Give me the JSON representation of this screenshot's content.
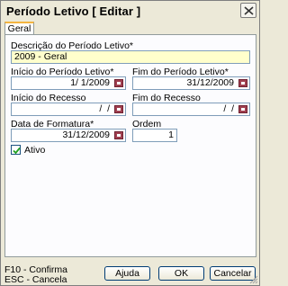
{
  "window": {
    "title": "Período Letivo [ Editar ]"
  },
  "tabs": [
    {
      "label": "Geral"
    }
  ],
  "form": {
    "descricao": {
      "label": "Descrição do Período Letivo*",
      "value": "2009 - Geral"
    },
    "inicio_periodo": {
      "label": "Início do Período Letivo*",
      "value": "1/ 1/2009"
    },
    "fim_periodo": {
      "label": "Fim do Período Letivo*",
      "value": "31/12/2009"
    },
    "inicio_recesso": {
      "label": "Início do Recesso",
      "value": " /  /"
    },
    "fim_recesso": {
      "label": "Fim do Recesso",
      "value": " /  /"
    },
    "data_formatura": {
      "label": "Data de Formatura*",
      "value": "31/12/2009"
    },
    "ordem": {
      "label": "Ordem",
      "value": "1"
    },
    "ativo": {
      "label": "Ativo",
      "checked": true
    }
  },
  "footer": {
    "shortcut_confirm": "F10 - Confirma",
    "shortcut_cancel": "ESC - Cancela",
    "help_label": "Ajuda",
    "ok_label": "OK",
    "cancel_label": "Cancelar"
  },
  "icons": [
    "close-icon",
    "calendar-icon",
    "check-icon",
    "resize-grip-icon"
  ]
}
